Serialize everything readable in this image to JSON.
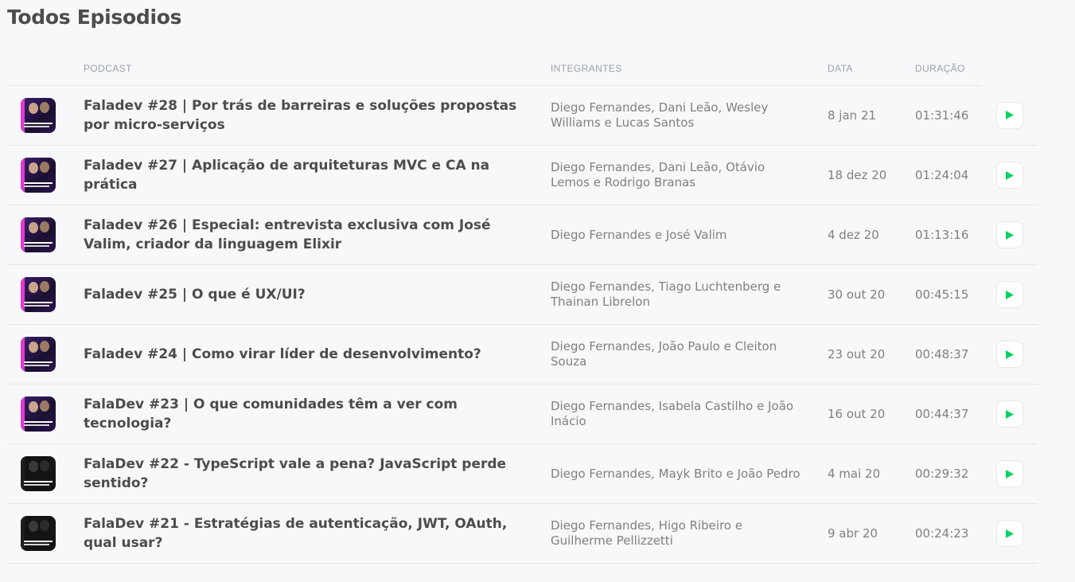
{
  "heading": "Todos Episodios",
  "columns": {
    "podcast": "Podcast",
    "members": "Integrantes",
    "date": "Data",
    "duration": "Duração"
  },
  "colors": {
    "play": "#04d361",
    "accent": "#8257e5",
    "pink": "#e03ad0"
  },
  "episodes": [
    {
      "title": "Faladev #28 | Por trás de barreiras e soluções propostas por micro-serviços",
      "members": "Diego Fernandes, Dani Leão, Wesley Williams e Lucas Santos",
      "date": "8 jan 21",
      "duration": "01:31:46",
      "thumb": "purple"
    },
    {
      "title": "Faladev #27 | Aplicação de arquiteturas MVC e CA na prática",
      "members": "Diego Fernandes, Dani Leão, Otávio Lemos e Rodrigo Branas",
      "date": "18 dez 20",
      "duration": "01:24:04",
      "thumb": "purple"
    },
    {
      "title": "Faladev #26 | Especial: entrevista exclusiva com José Valim, criador da linguagem Elixir",
      "members": "Diego Fernandes e José Valim",
      "date": "4 dez 20",
      "duration": "01:13:16",
      "thumb": "purple"
    },
    {
      "title": "Faladev #25 | O que é UX/UI?",
      "members": "Diego Fernandes, Tiago Luchtenberg e Thainan Librelon",
      "date": "30 out 20",
      "duration": "00:45:15",
      "thumb": "purple"
    },
    {
      "title": "Faladev #24 | Como virar líder de desenvolvimento?",
      "members": "Diego Fernandes, João Paulo e Cleiton Souza",
      "date": "23 out 20",
      "duration": "00:48:37",
      "thumb": "purple"
    },
    {
      "title": "FalaDev #23 | O que comunidades têm a ver com tecnologia?",
      "members": "Diego Fernandes, Isabela Castilho e João Inácio",
      "date": "16 out 20",
      "duration": "00:44:37",
      "thumb": "purple"
    },
    {
      "title": "FalaDev #22 - TypeScript vale a pena? JavaScript perde sentido?",
      "members": "Diego Fernandes, Mayk Brito e João Pedro",
      "date": "4 mai 20",
      "duration": "00:29:32",
      "thumb": "dark"
    },
    {
      "title": "FalaDev #21 - Estratégias de autenticação, JWT, OAuth, qual usar?",
      "members": "Diego Fernandes, Higo Ribeiro e Guilherme Pellizzetti",
      "date": "9 abr 20",
      "duration": "00:24:23",
      "thumb": "dark"
    }
  ]
}
